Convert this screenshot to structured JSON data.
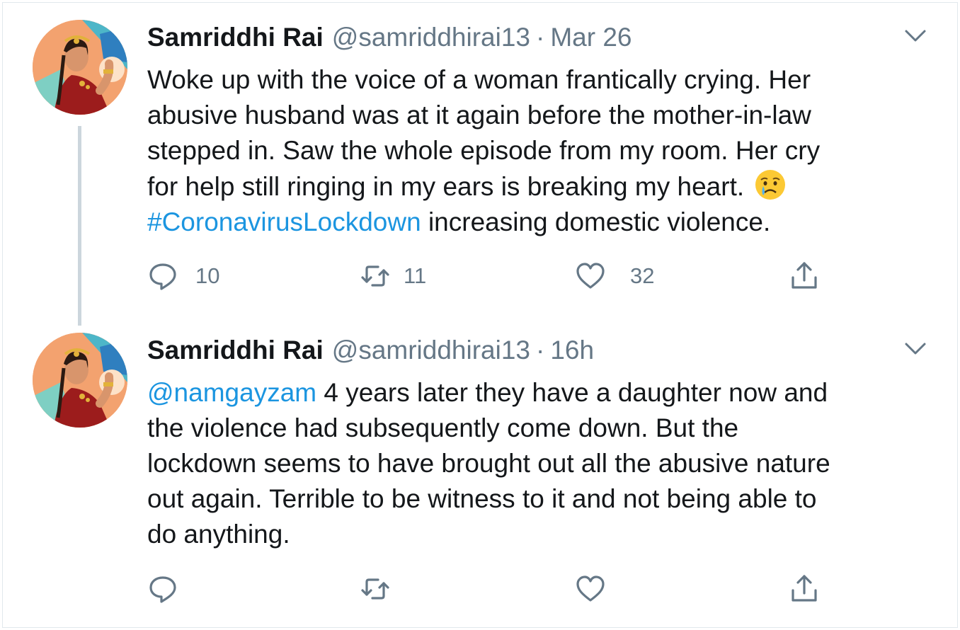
{
  "tweets": [
    {
      "author": {
        "name": "Samriddhi Rai",
        "handle": "@samriddhirai13"
      },
      "separator": "·",
      "time": "Mar 26",
      "text_lines": [
        "Woke up with the voice of a woman frantically crying. Her",
        "abusive husband was at it again before the mother-in-law",
        "stepped in. Saw the whole episode from my room. Her cry",
        "for help still ringing in my ears is breaking my heart. "
      ],
      "hashtag": "#CoronavirusLockdown",
      "after_hashtag": " increasing domestic violence.",
      "emoji": "crying-face",
      "counts": {
        "replies": "10",
        "retweets": "11",
        "likes": "32"
      }
    },
    {
      "author": {
        "name": "Samriddhi Rai",
        "handle": "@samriddhirai13"
      },
      "separator": "·",
      "time": "16h",
      "mention": "@namgayzam",
      "after_mention": " 4 years later they have a daughter now and",
      "text_lines": [
        "the violence had subsequently come down. But the",
        "lockdown seems to have brought out all the abusive nature",
        "out again. Terrible to be witness to it and not being able to",
        "do anything."
      ]
    }
  ],
  "icons": [
    "chevron-down-icon",
    "reply-icon",
    "retweet-icon",
    "like-icon",
    "share-icon",
    "crying-face"
  ],
  "colors": {
    "link": "#1b95e0",
    "muted": "#657786",
    "text": "#14171a",
    "thread_line": "#ccd6dd"
  }
}
